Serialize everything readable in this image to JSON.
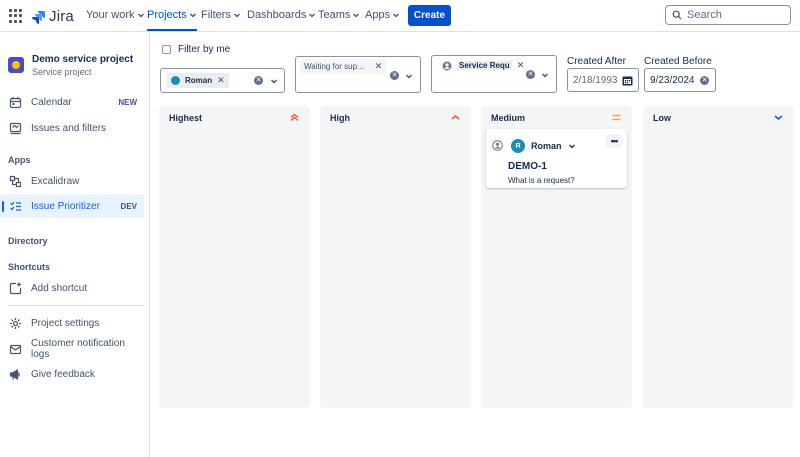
{
  "topnav": {
    "logo_text": "Jira",
    "items": [
      {
        "label": "Your work"
      },
      {
        "label": "Projects"
      },
      {
        "label": "Filters"
      },
      {
        "label": "Dashboards"
      },
      {
        "label": "Teams"
      },
      {
        "label": "Apps"
      }
    ],
    "create_label": "Create",
    "search_placeholder": "Search",
    "accent_color": "#0052cc"
  },
  "sidebar": {
    "project": {
      "name": "Demo service project",
      "type": "Service project"
    },
    "calendar": {
      "label": "Calendar",
      "badge": "NEW"
    },
    "issues_filters": {
      "label": "Issues and filters"
    },
    "apps_heading": "Apps",
    "excalidraw": {
      "label": "Excalidraw"
    },
    "issue_prioritizer": {
      "label": "Issue Prioritizer",
      "badge": "DEV"
    },
    "directory_heading": "Directory",
    "shortcuts_heading": "Shortcuts",
    "add_shortcut": {
      "label": "Add shortcut"
    },
    "project_settings": {
      "label": "Project settings"
    },
    "customer_logs": {
      "label": "Customer notification logs"
    },
    "give_feedback": {
      "label": "Give feedback"
    }
  },
  "filters": {
    "filter_by_me": "Filter by me",
    "assignee_chip": "Roman",
    "status_chip": "Waiting for sup...",
    "request_type_chip": "Service Requ",
    "created_after_label": "Created After",
    "created_after_value": "2/18/1993",
    "created_before_label": "Created Before",
    "created_before_value": "9/23/2024"
  },
  "board": {
    "columns": [
      {
        "title": "Highest",
        "color": "#ff5630"
      },
      {
        "title": "High",
        "color": "#ff5630"
      },
      {
        "title": "Medium",
        "color": "#ffab00"
      },
      {
        "title": "Low",
        "color": "#0065ff"
      }
    ],
    "card": {
      "assignee_initial": "R",
      "assignee": "Roman",
      "more": "•••",
      "key": "DEMO-1",
      "summary": "What is a request?"
    }
  }
}
